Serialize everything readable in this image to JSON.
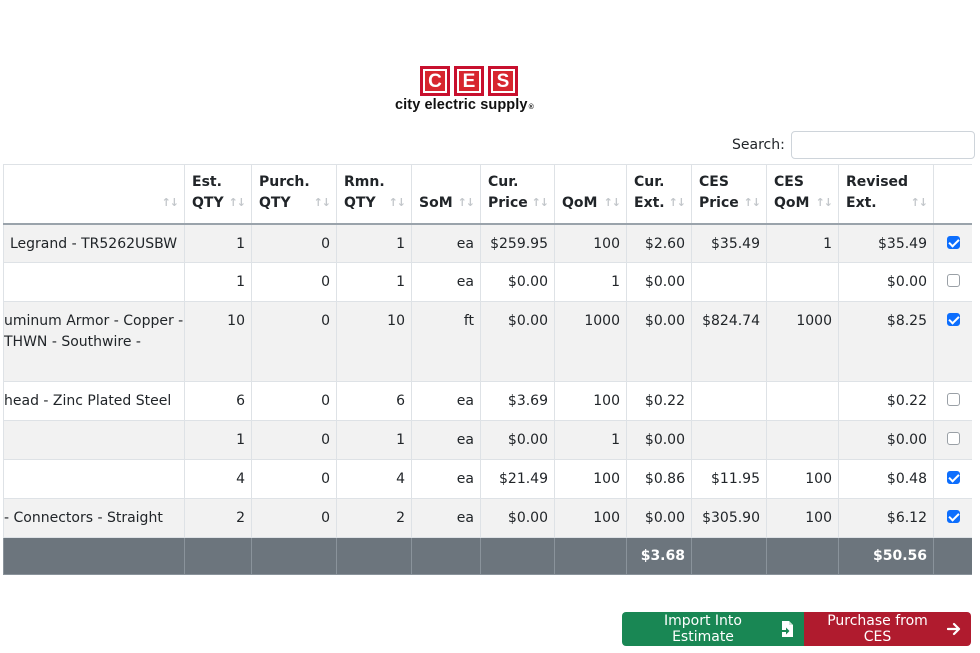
{
  "logo": {
    "letters": [
      "C",
      "E",
      "S"
    ],
    "tagline": "city electric supply",
    "registered": "®",
    "brand_color": "#c8102e"
  },
  "search": {
    "label": "Search:",
    "value": "",
    "placeholder": ""
  },
  "table": {
    "columns": [
      {
        "line1": "",
        "line2": ""
      },
      {
        "line1": "Est.",
        "line2": "QTY"
      },
      {
        "line1": "Purch.",
        "line2": "QTY"
      },
      {
        "line1": "Rmn.",
        "line2": "QTY"
      },
      {
        "line1": "",
        "line2": "SoM"
      },
      {
        "line1": "Cur.",
        "line2": "Price"
      },
      {
        "line1": "",
        "line2": "QoM"
      },
      {
        "line1": "Cur.",
        "line2": "Ext."
      },
      {
        "line1": "CES",
        "line2": "Price"
      },
      {
        "line1": "CES",
        "line2": "QoM"
      },
      {
        "line1": "Revised",
        "line2": "Ext."
      }
    ],
    "sort_icon": "↑↓",
    "rows": [
      {
        "desc": "Legrand - TR5262USBW",
        "est_qty": "1",
        "purch_qty": "0",
        "rmn_qty": "1",
        "som": "ea",
        "cur_price": "$259.95",
        "qom": "100",
        "cur_ext": "$2.60",
        "ces_price": "$35.49",
        "ces_qom": "1",
        "revised_ext": "$35.49",
        "checked": true
      },
      {
        "desc": "",
        "est_qty": "1",
        "purch_qty": "0",
        "rmn_qty": "1",
        "som": "ea",
        "cur_price": "$0.00",
        "qom": "1",
        "cur_ext": "$0.00",
        "ces_price": "",
        "ces_qom": "",
        "revised_ext": "$0.00",
        "checked": false
      },
      {
        "desc": "uminum Armor - Copper - THWN - Southwire -",
        "est_qty": "10",
        "purch_qty": "0",
        "rmn_qty": "10",
        "som": "ft",
        "cur_price": "$0.00",
        "qom": "1000",
        "cur_ext": "$0.00",
        "ces_price": "$824.74",
        "ces_qom": "1000",
        "revised_ext": "$8.25",
        "checked": true
      },
      {
        "desc": "head - Zinc Plated Steel",
        "est_qty": "6",
        "purch_qty": "0",
        "rmn_qty": "6",
        "som": "ea",
        "cur_price": "$3.69",
        "qom": "100",
        "cur_ext": "$0.22",
        "ces_price": "",
        "ces_qom": "",
        "revised_ext": "$0.22",
        "checked": false
      },
      {
        "desc": "",
        "est_qty": "1",
        "purch_qty": "0",
        "rmn_qty": "1",
        "som": "ea",
        "cur_price": "$0.00",
        "qom": "1",
        "cur_ext": "$0.00",
        "ces_price": "",
        "ces_qom": "",
        "revised_ext": "$0.00",
        "checked": false
      },
      {
        "desc": "",
        "est_qty": "4",
        "purch_qty": "0",
        "rmn_qty": "4",
        "som": "ea",
        "cur_price": "$21.49",
        "qom": "100",
        "cur_ext": "$0.86",
        "ces_price": "$11.95",
        "ces_qom": "100",
        "revised_ext": "$0.48",
        "checked": true
      },
      {
        "desc": "- Connectors - Straight",
        "est_qty": "2",
        "purch_qty": "0",
        "rmn_qty": "2",
        "som": "ea",
        "cur_price": "$0.00",
        "qom": "100",
        "cur_ext": "$0.00",
        "ces_price": "$305.90",
        "ces_qom": "100",
        "revised_ext": "$6.12",
        "checked": true
      }
    ],
    "footer": {
      "cur_ext_total": "$3.68",
      "revised_ext_total": "$50.56"
    }
  },
  "buttons": {
    "import_label": "Import Into Estimate",
    "import_icon": "file-import-icon",
    "purchase_label": "Purchase from CES",
    "purchase_icon": "arrow-right-icon",
    "import_color": "#198754",
    "purchase_color": "#b01b2e"
  }
}
